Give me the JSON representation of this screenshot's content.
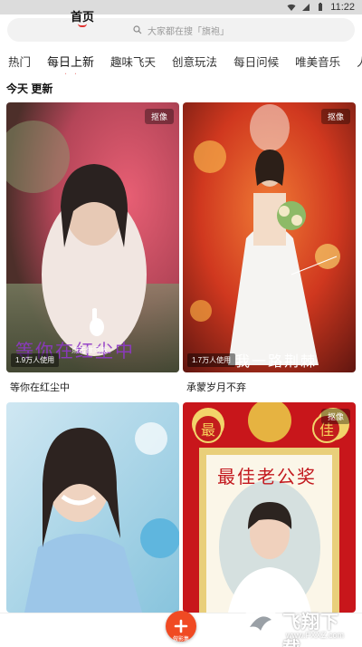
{
  "status": {
    "time": "11:22"
  },
  "search": {
    "placeholder": "大家都在搜「旗袍」"
  },
  "tabs": [
    "热门",
    "每日上新",
    "趣味飞天",
    "创意玩法",
    "每日问候",
    "唯美音乐",
    "人"
  ],
  "section": {
    "title": "今天 更新"
  },
  "cards": [
    {
      "badge": "抠像",
      "uses": "1.9万人使用",
      "caption": "等你在红尘中",
      "overlay_text": "等你在红尘中",
      "tap_hint": "点击做同款"
    },
    {
      "badge": "抠像",
      "uses": "1.7万人使用",
      "caption": "承蒙岁月不弃",
      "overlay_text": "我一路荆棘"
    },
    {
      "badge": "",
      "caption": ""
    },
    {
      "badge": "抠像",
      "caption": "",
      "poster_text": "最佳老公奖",
      "seal_left": "最",
      "seal_right": "佳"
    }
  ],
  "bottom_nav": {
    "home": "首页",
    "create": "做影集"
  },
  "watermark": {
    "text": "飞翔下载",
    "url": "www.FXXZ.com"
  },
  "colors": {
    "accent": "#e0322f",
    "fab": "#f04a23"
  }
}
